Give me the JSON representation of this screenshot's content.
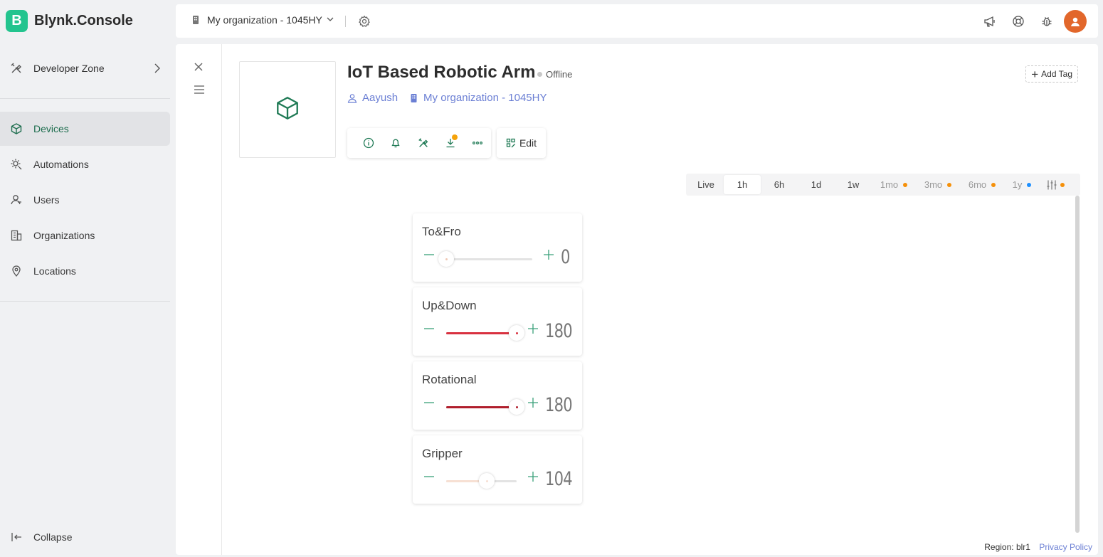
{
  "app": {
    "logo_letter": "B",
    "name": "Blynk.Console"
  },
  "sidebar": {
    "developer_zone": "Developer Zone",
    "items": [
      {
        "label": "Devices",
        "icon": "cube-icon",
        "active": true
      },
      {
        "label": "Automations",
        "icon": "automation-icon",
        "active": false
      },
      {
        "label": "Users",
        "icon": "users-icon",
        "active": false
      },
      {
        "label": "Organizations",
        "icon": "building-icon",
        "active": false
      },
      {
        "label": "Locations",
        "icon": "map-pin-icon",
        "active": false
      }
    ],
    "collapse": "Collapse"
  },
  "topbar": {
    "org_name": "My organization - 1045HY",
    "icons": [
      "megaphone-icon",
      "lifebuoy-icon",
      "bug-icon",
      "avatar"
    ]
  },
  "device": {
    "name": "IoT Based Robotic Arm",
    "status": "Offline",
    "owner": "Aayush",
    "organization": "My organization - 1045HY",
    "add_tag": "Add Tag",
    "edit": "Edit"
  },
  "time_ranges": [
    {
      "label": "Live",
      "active": false,
      "dim": false,
      "dot": null
    },
    {
      "label": "1h",
      "active": true,
      "dim": false,
      "dot": null
    },
    {
      "label": "6h",
      "active": false,
      "dim": false,
      "dot": null
    },
    {
      "label": "1d",
      "active": false,
      "dim": false,
      "dot": null
    },
    {
      "label": "1w",
      "active": false,
      "dim": false,
      "dot": null
    },
    {
      "label": "1mo",
      "active": false,
      "dim": true,
      "dot": "#f5900a"
    },
    {
      "label": "3mo",
      "active": false,
      "dim": true,
      "dot": "#f5900a"
    },
    {
      "label": "6mo",
      "active": false,
      "dim": true,
      "dot": "#f5900a"
    },
    {
      "label": "1y",
      "active": false,
      "dim": true,
      "dot": "#1e90ff"
    }
  ],
  "widgets": [
    {
      "title": "To&Fro",
      "value": "0",
      "fraction": 0.0,
      "color": "#f0c9b5"
    },
    {
      "title": "Up&Down",
      "value": "180",
      "fraction": 1.0,
      "color": "#d8313f"
    },
    {
      "title": "Rotational",
      "value": "180",
      "fraction": 1.0,
      "color": "#b01e2c"
    },
    {
      "title": "Gripper",
      "value": "104",
      "fraction": 0.578,
      "color": "#f7e0d3"
    }
  ],
  "footer": {
    "region": "Region: blr1",
    "privacy": "Privacy Policy"
  },
  "colors": {
    "brand": "#23c48e",
    "link": "#6b7fd4",
    "active_nav_text": "#1f6e4f",
    "icon_green": "#1f7a55"
  }
}
